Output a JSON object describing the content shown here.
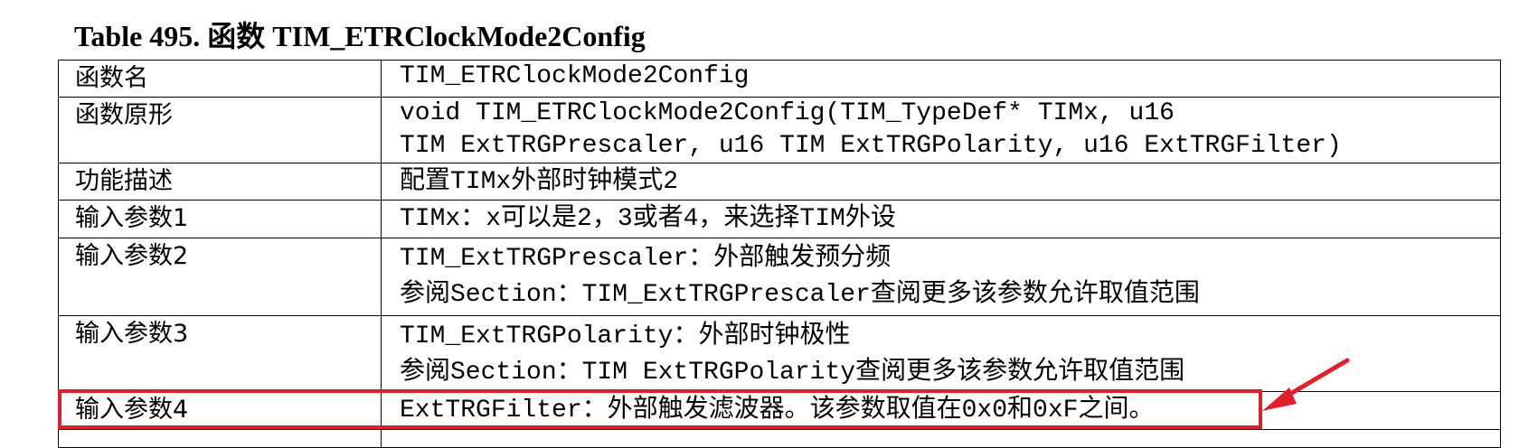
{
  "caption": "Table 495.  函数 TIM_ETRClockMode2Config",
  "rows": [
    {
      "key": "函数名",
      "lines": [
        "TIM_ETRClockMode2Config"
      ]
    },
    {
      "key": "函数原形",
      "lines": [
        "void TIM_ETRClockMode2Config(TIM_TypeDef* TIMx, u16",
        "TIM ExtTRGPrescaler, u16 TIM ExtTRGPolarity, u16 ExtTRGFilter)"
      ]
    },
    {
      "key": "功能描述",
      "lines": [
        "配置TIMx外部时钟模式2"
      ]
    },
    {
      "key": "输入参数1",
      "lines": [
        "TIMx：x可以是2，3或者4，来选择TIM外设"
      ]
    },
    {
      "key": "输入参数2",
      "lines": [
        "TIM_ExtTRGPrescaler：外部触发预分频",
        "参阅Section：TIM_ExtTRGPrescaler查阅更多该参数允许取值范围"
      ]
    },
    {
      "key": "输入参数3",
      "lines": [
        "TIM_ExtTRGPolarity：外部时钟极性",
        "参阅Section：TIM ExtTRGPolarity查阅更多该参数允许取值范围"
      ]
    },
    {
      "key": "输入参数4",
      "lines": [
        "ExtTRGFilter：外部触发滤波器。该参数取值在0x0和0xF之间。"
      ]
    }
  ],
  "highlight_color": "#e0202a"
}
